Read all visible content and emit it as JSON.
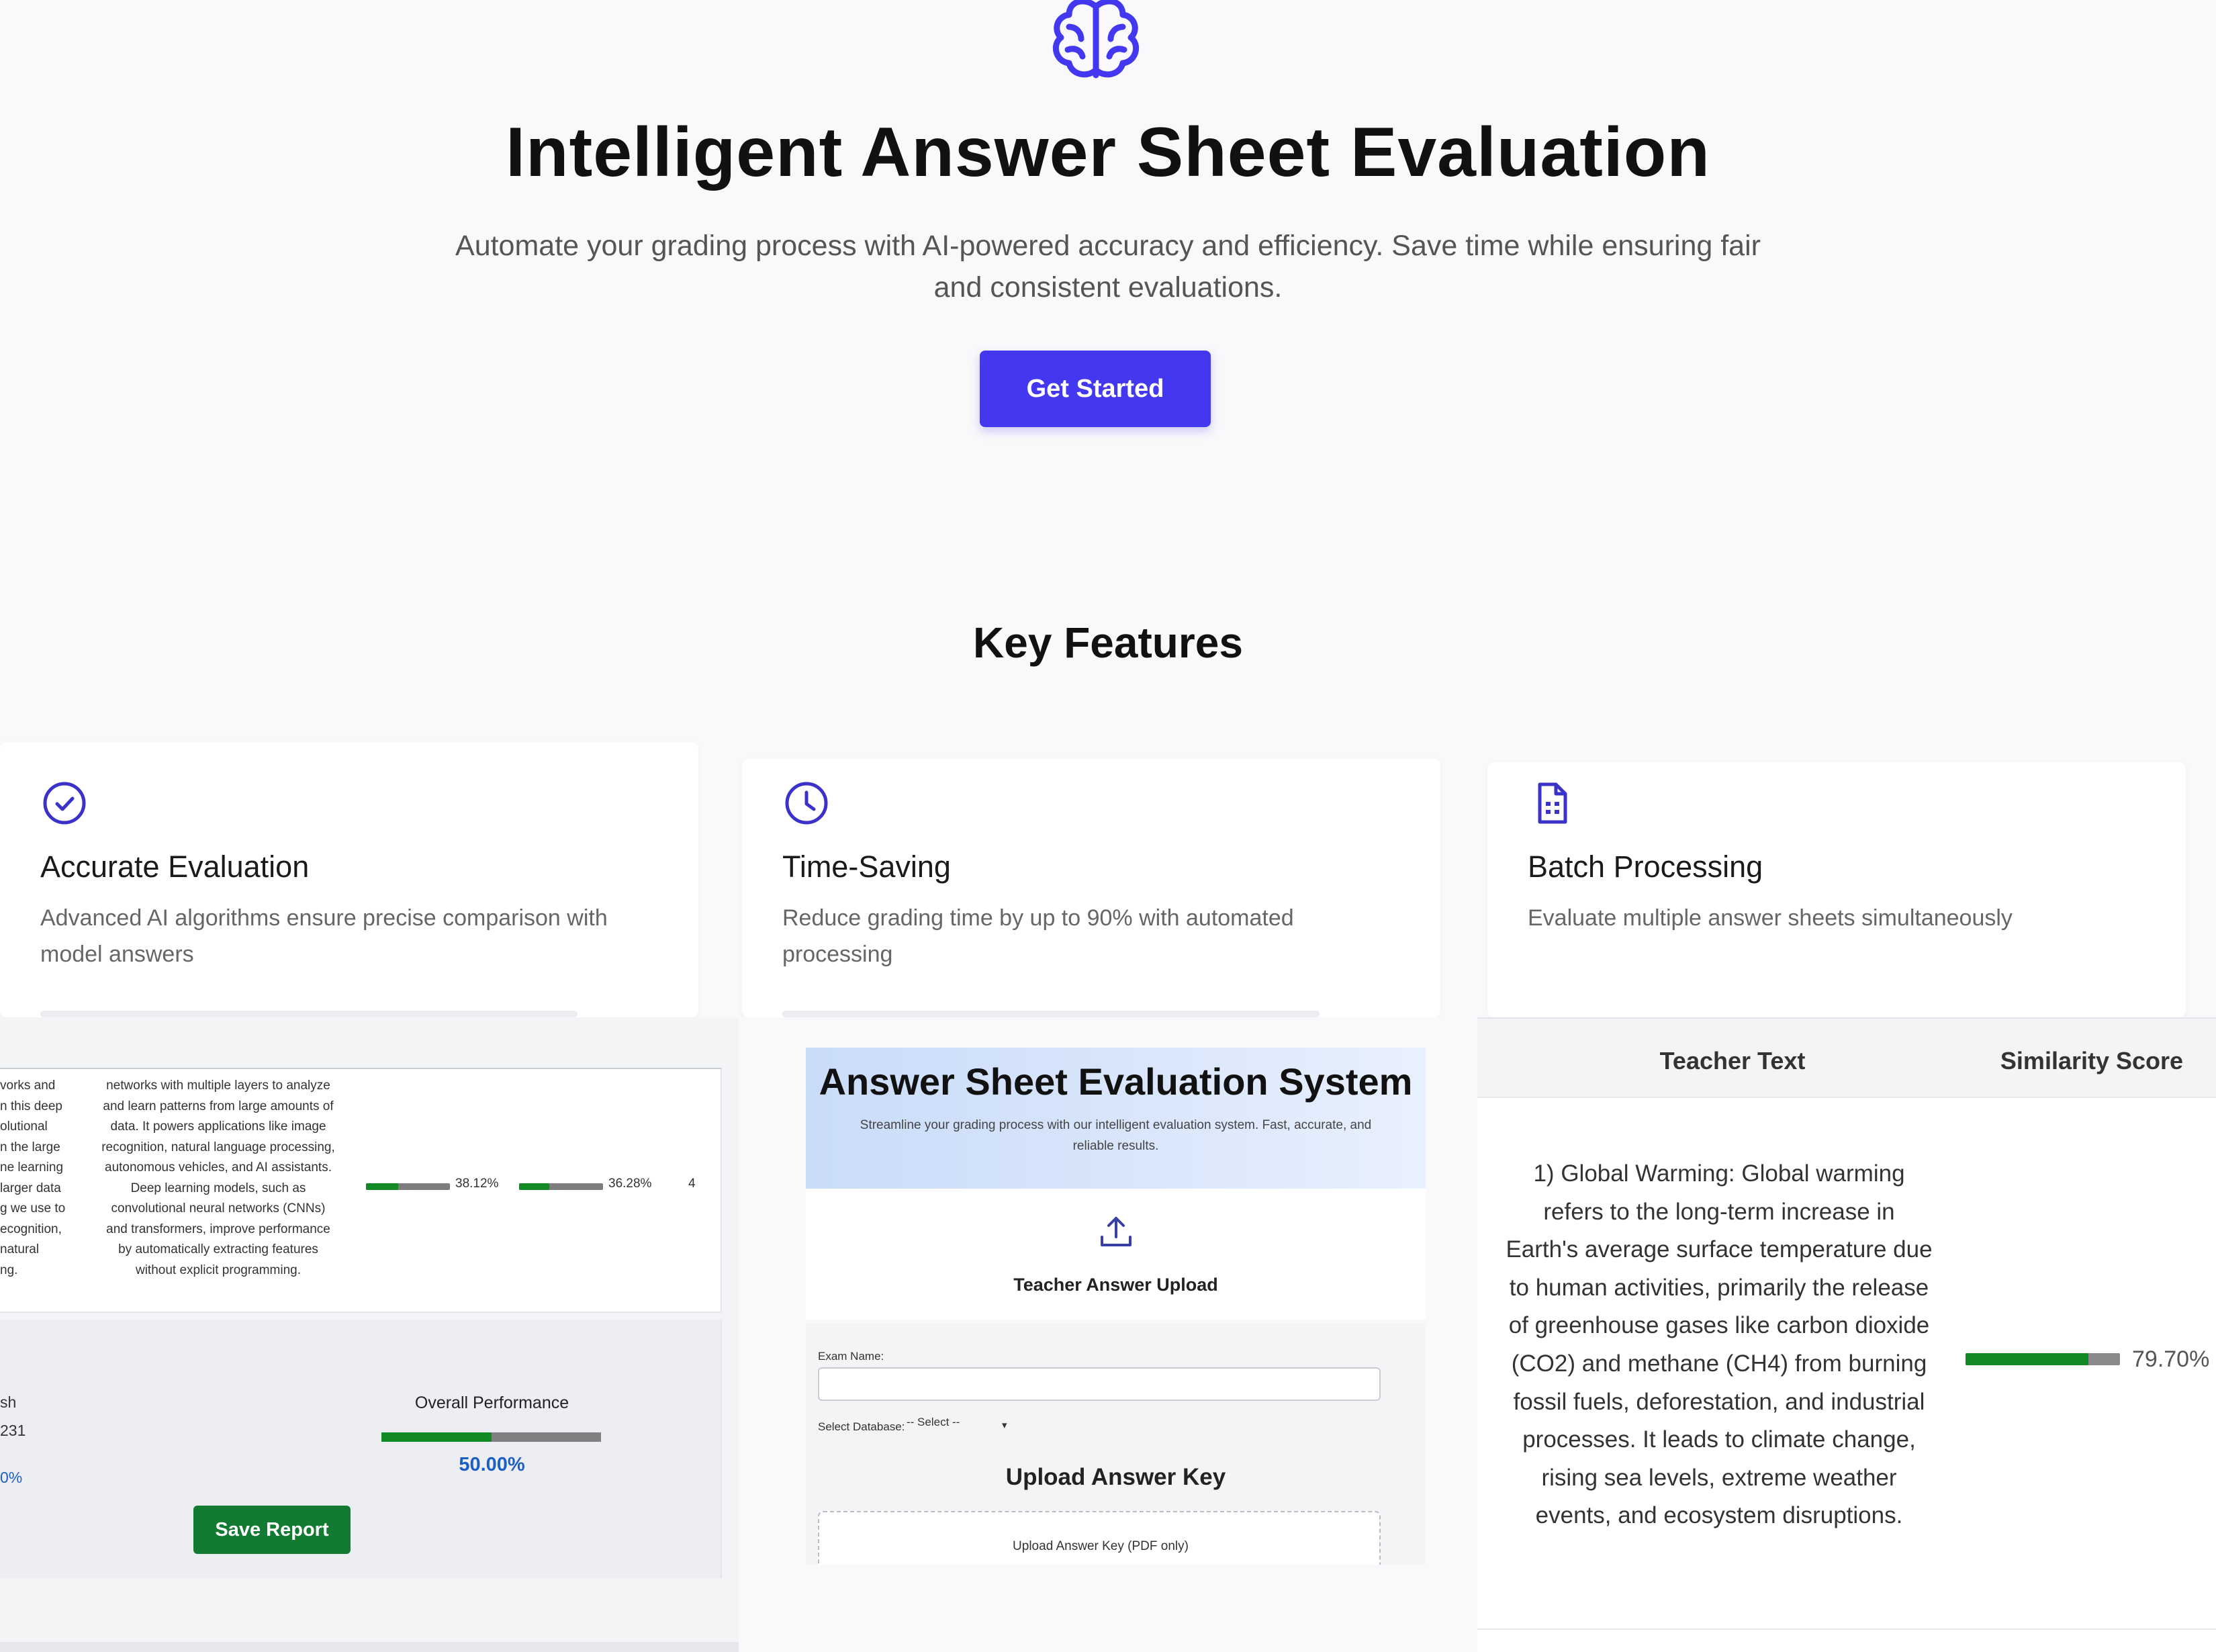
{
  "hero": {
    "title": "Intelligent Answer Sheet Evaluation",
    "subtitle": "Automate your grading process with AI-powered accuracy and efficiency. Save time while ensuring fair and consistent evaluations.",
    "cta_label": "Get Started",
    "icon": "brain-icon",
    "accent_color": "#4338f0"
  },
  "features": {
    "heading": "Key Features",
    "cards": [
      {
        "icon": "check-circle-icon",
        "title": "Accurate Evaluation",
        "description": "Advanced AI algorithms ensure precise comparison with model answers"
      },
      {
        "icon": "clock-icon",
        "title": "Time-Saving",
        "description": "Reduce grading time by up to 90% with automated processing"
      },
      {
        "icon": "document-icon",
        "title": "Batch Processing",
        "description": "Evaluate multiple answer sheets simultaneously"
      }
    ]
  },
  "report_panel": {
    "col_a_lines": [
      "vorks and",
      "n this deep",
      "olutional",
      "n the large",
      "ne learning",
      "larger data",
      "g we use to",
      "ecognition,",
      "natural",
      "ng."
    ],
    "col_b_lines": [
      "networks with multiple layers to analyze",
      "and learn patterns from large amounts of",
      "data. It powers applications like image",
      "recognition, natural language processing,",
      "autonomous vehicles, and AI assistants.",
      "Deep learning models, such as",
      "convolutional neural networks (CNNs)",
      "and transformers, improve performance",
      "by automatically extracting features",
      "without explicit programming."
    ],
    "score1": {
      "value": 38.12,
      "label": "38.12%"
    },
    "score2": {
      "value": 36.28,
      "label": "36.28%"
    },
    "row_marks": "4",
    "summary_left": [
      "sh",
      "231",
      "0%"
    ],
    "overall_label": "Overall Performance",
    "overall": {
      "value": 50.0,
      "label": "50.00%"
    },
    "save_label": "Save Report",
    "success_color": "#137a32"
  },
  "app_panel": {
    "title": "Answer Sheet Evaluation System",
    "subtitle": "Streamline your grading process with our intelligent evaluation system. Fast, accurate, and reliable results.",
    "upload_icon": "upload-icon",
    "teacher_upload_label": "Teacher Answer Upload",
    "exam_name_label": "Exam Name:",
    "exam_name_value": "",
    "database_label": "Select Database:",
    "database_selected": "-- Select --",
    "answer_key_heading": "Upload Answer Key",
    "dropzone_label": "Upload Answer Key (PDF only)"
  },
  "similarity_panel": {
    "col_teacher": "Teacher Text",
    "col_score": "Similarity Score",
    "teacher_text": "1) Global Warming: Global warming refers to the long-term increase in Earth's average surface temperature due to human activities, primarily the release of greenhouse gases like carbon dioxide (CO2) and methane (CH4) from burning fossil fuels, deforestation, and industrial processes. It leads to climate change, rising sea levels, extreme weather events, and ecosystem disruptions.",
    "score": {
      "value": 79.7,
      "label": "79.70%"
    }
  }
}
